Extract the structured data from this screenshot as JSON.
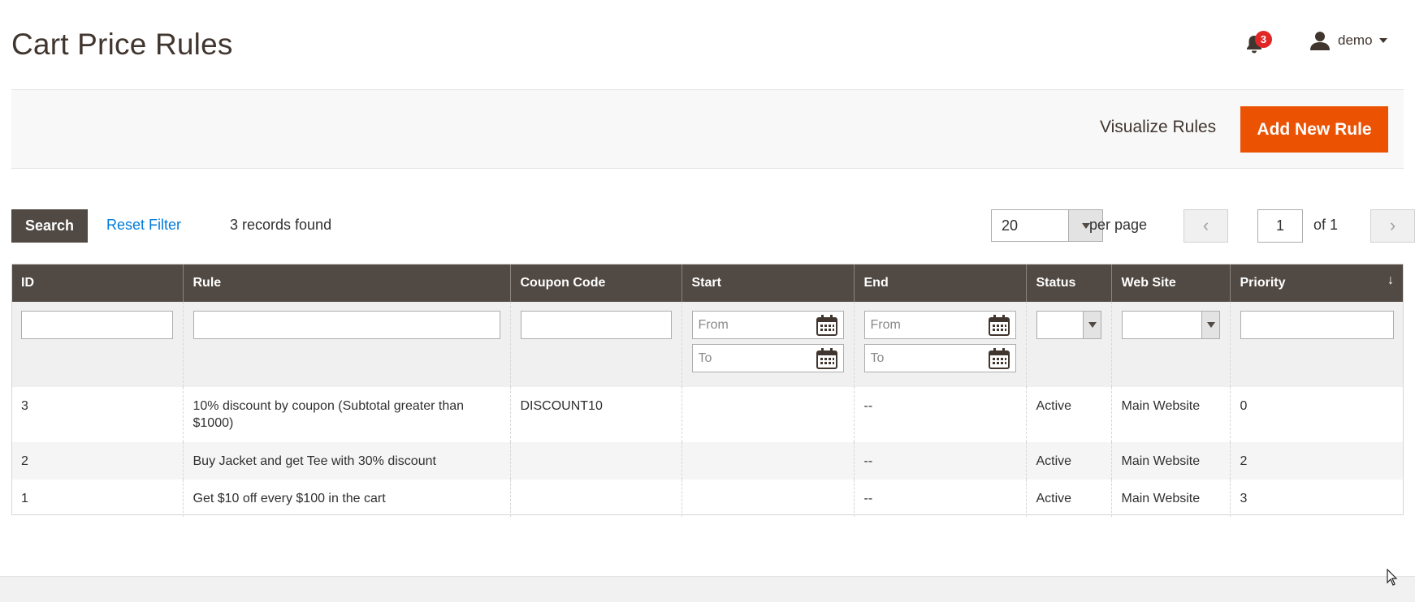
{
  "page": {
    "title": "Cart Price Rules"
  },
  "header": {
    "notification_count": "3",
    "user_name": "demo"
  },
  "actions": {
    "visualize_label": "Visualize Rules",
    "add_label": "Add New Rule"
  },
  "toolbar": {
    "search_label": "Search",
    "reset_label": "Reset Filter",
    "records_text": "3 records found",
    "per_page_value": "20",
    "per_page_label": "per page",
    "current_page": "1",
    "page_of": "of 1"
  },
  "grid": {
    "columns": [
      "ID",
      "Rule",
      "Coupon Code",
      "Start",
      "End",
      "Status",
      "Web Site",
      "Priority"
    ],
    "sort_indicator": "↓",
    "filters": {
      "from_placeholder": "From",
      "to_placeholder": "To"
    },
    "rows": [
      {
        "id": "3",
        "rule": "10% discount by coupon (Subtotal greater than $1000)",
        "coupon": "DISCOUNT10",
        "start": "",
        "end": "--",
        "status": "Active",
        "website": "Main Website",
        "priority": "0"
      },
      {
        "id": "2",
        "rule": "Buy Jacket and get Tee with 30% discount",
        "coupon": "",
        "start": "",
        "end": "--",
        "status": "Active",
        "website": "Main Website",
        "priority": "2"
      },
      {
        "id": "1",
        "rule": "Get $10 off every $100 in the cart",
        "coupon": "",
        "start": "",
        "end": "--",
        "status": "Active",
        "website": "Main Website",
        "priority": "3"
      }
    ]
  },
  "colors": {
    "header_bg": "#514943",
    "primary": "#eb5202",
    "link": "#007bdb",
    "badge": "#e22626"
  }
}
